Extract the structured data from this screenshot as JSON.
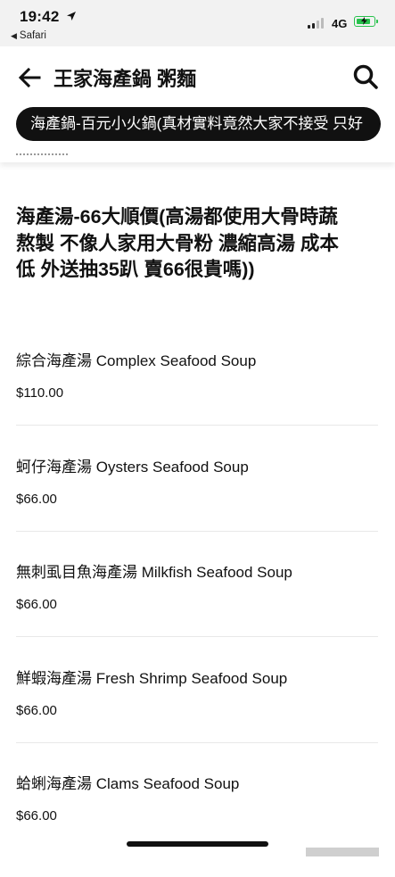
{
  "status_bar": {
    "time": "19:42",
    "back_app": "Safari",
    "network": "4G"
  },
  "header": {
    "title": "王家海產鍋 粥麵",
    "category_prev_partial": ")",
    "category_active": "海產鍋-百元小火鍋(真材實料竟然大家不接受 只好"
  },
  "section": {
    "title": "海產湯-66大順價(高湯都使用大骨時蔬熬製 不像人家用大骨粉 濃縮高湯 成本低 外送抽35趴 賣66很貴嗎))"
  },
  "items": [
    {
      "name": "綜合海產湯 Complex Seafood Soup",
      "price": "$110.00"
    },
    {
      "name": "蚵仔海產湯 Oysters Seafood Soup",
      "price": "$66.00"
    },
    {
      "name": "無刺虱目魚海產湯  Milkfish Seafood Soup",
      "price": "$66.00"
    },
    {
      "name": "鮮蝦海產湯 Fresh Shrimp Seafood  Soup",
      "price": "$66.00"
    },
    {
      "name": "蛤蜊海產湯 Clams Seafood Soup",
      "price": "$66.00"
    }
  ],
  "icons": {
    "back": "arrow-left-icon",
    "search": "search-icon",
    "location": "location-arrow-icon",
    "battery": "battery-charging-icon",
    "signal": "signal-bars-icon"
  },
  "colors": {
    "active_tab_bg": "#111111",
    "battery": "#27c24c",
    "status_bar_bg": "#f2f2f2"
  }
}
